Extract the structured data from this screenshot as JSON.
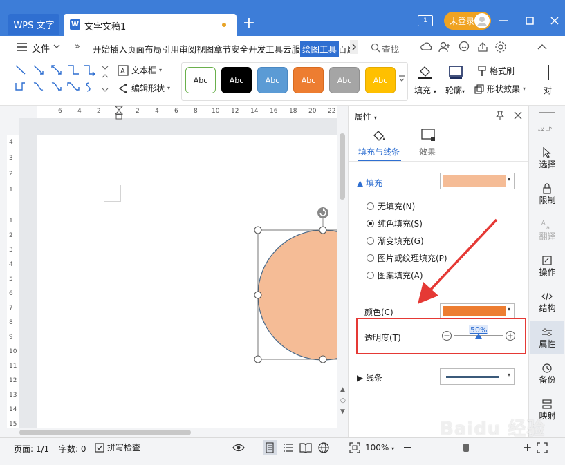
{
  "titlebar": {
    "app_tab": "WPS 文字",
    "doc_tab": "文字文稿1",
    "doc_icon_letter": "W",
    "page_count_icon": "1",
    "login_label": "未登录"
  },
  "menu": {
    "file_label": "文件",
    "tabs": [
      "开始",
      "插入",
      "页面布局",
      "引用",
      "审阅",
      "视图",
      "章节",
      "安全",
      "开发工具",
      "云服务"
    ],
    "active_tab": "绘图工具",
    "overflow_tab": "百周",
    "search_label": "查找"
  },
  "ribbon": {
    "text_box": "文本框",
    "edit_shape": "编辑形状",
    "styles": [
      {
        "label": "Abc",
        "bg": "#ffffff",
        "fg": "#222222",
        "border": "#6ab04c"
      },
      {
        "label": "Abc",
        "bg": "#000000",
        "fg": "#ffffff",
        "border": "#000000"
      },
      {
        "label": "Abc",
        "bg": "#5b9bd5",
        "fg": "#ffffff",
        "border": "#4a88c2"
      },
      {
        "label": "Abc",
        "bg": "#ed7d31",
        "fg": "#ffffff",
        "border": "#d86b20"
      },
      {
        "label": "Abc",
        "bg": "#a5a5a5",
        "fg": "#ffffff",
        "border": "#909090"
      },
      {
        "label": "Abc",
        "bg": "#ffc000",
        "fg": "#ffffff",
        "border": "#e4ab00"
      }
    ],
    "fill": "填充",
    "outline": "轮廓",
    "format_painter": "格式刷",
    "shape_effects": "形状效果",
    "cut_off": "对"
  },
  "ruler": {
    "h_ticks": [
      "6",
      "4",
      "2",
      "2",
      "4",
      "6",
      "8",
      "10",
      "12",
      "14",
      "16",
      "18",
      "20",
      "22"
    ],
    "v_ticks": [
      "4",
      "3",
      "2",
      "1",
      "1",
      "2",
      "3",
      "4",
      "5",
      "6",
      "7",
      "8",
      "9",
      "10",
      "11",
      "12",
      "13",
      "14",
      "15"
    ]
  },
  "props": {
    "title": "属性",
    "tab_fill_line": "填充与线条",
    "tab_effect": "效果",
    "section_fill": "填充",
    "fill_swatch_color": "#f5bc96",
    "options": [
      "无填充(N)",
      "纯色填充(S)",
      "渐变填充(G)",
      "图片或纹理填充(P)",
      "图案填充(A)"
    ],
    "selected_option": 1,
    "color_label": "颜色(C)",
    "color_value": "#ed7d31",
    "transparency_label": "透明度(T)",
    "transparency_value": "50%",
    "transparency_fraction": 0.5,
    "section_line": "线条",
    "line_color": "#3b5a7a"
  },
  "sidebar": {
    "items": [
      "选择",
      "限制",
      "翻译",
      "操作",
      "结构",
      "属性",
      "备份",
      "映射"
    ]
  },
  "statusbar": {
    "page": "页面: 1/1",
    "words": "字数: 0",
    "spellcheck": "拼写检查",
    "zoom": "100%",
    "watermark": "Baidu 经验"
  },
  "colors": {
    "shape_fill": "#f5bc96",
    "shape_stroke": "#4a6a8a",
    "highlight_red": "#e53935",
    "accent_blue": "#2f6fd1"
  }
}
